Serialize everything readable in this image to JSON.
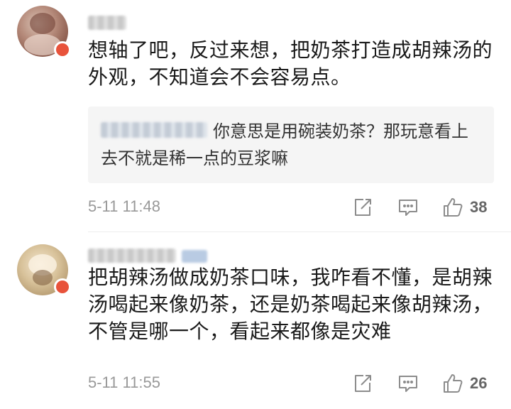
{
  "comments": [
    {
      "text": "想轴了吧，反过来想，把奶茶打造成胡辣汤的外观，不知道会不会容易点。",
      "reply": {
        "text": "你意思是用碗装奶茶？那玩意看上去不就是稀一点的豆浆嘛"
      },
      "time": "5-11 11:48",
      "likes": "38"
    },
    {
      "text": "把胡辣汤做成奶茶口味，我咋看不懂，是胡辣汤喝起来像奶茶，还是奶茶喝起来像胡辣汤，不管是哪一个，看起来都像是灾难",
      "time": "5-11 11:55",
      "likes": "26"
    }
  ],
  "icons": {
    "share": "share-icon",
    "reply": "comment-icon",
    "like": "thumbs-up-icon"
  },
  "colors": {
    "text": "#1a1a1a",
    "meta": "#999999",
    "reply_bg": "#f5f5f5",
    "badge": "#e8533b"
  }
}
